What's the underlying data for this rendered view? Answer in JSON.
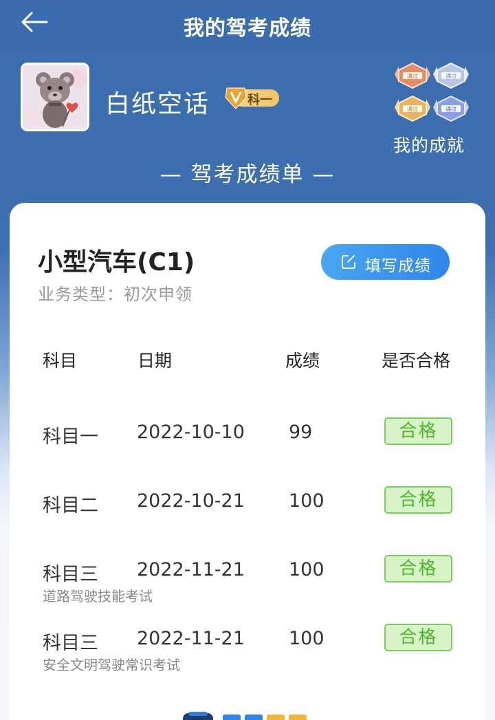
{
  "header": {
    "title": "我的驾考成绩"
  },
  "profile": {
    "username": "白纸空话",
    "level_badge": "科一",
    "achievements_label": "我的成就",
    "medal_text": "通过"
  },
  "section_title": "— 驾考成绩单 —",
  "exam": {
    "car_type": "小型汽车(C1)",
    "business_type": "业务类型：初次申领",
    "fill_button": "填写成绩"
  },
  "table": {
    "headers": [
      "科目",
      "日期",
      "成绩",
      "是否合格"
    ],
    "rows": [
      {
        "subject": "科目一",
        "date": "2022-10-10",
        "score": "99",
        "result": "合格",
        "note": ""
      },
      {
        "subject": "科目二",
        "date": "2022-10-21",
        "score": "100",
        "result": "合格",
        "note": ""
      },
      {
        "subject": "科目三",
        "date": "2022-11-21",
        "score": "100",
        "result": "合格",
        "note": "道路驾驶技能考试"
      },
      {
        "subject": "科目三",
        "date": "2022-11-21",
        "score": "100",
        "result": "合格",
        "note": "安全文明驾驶常识考试"
      }
    ]
  }
}
